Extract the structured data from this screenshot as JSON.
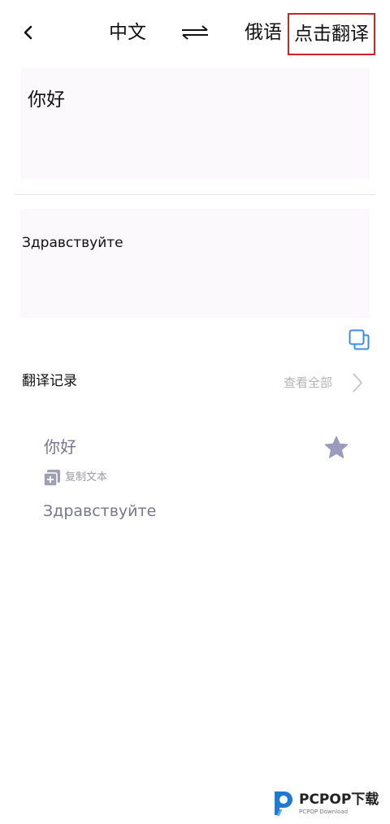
{
  "header": {
    "source_language": "中文",
    "target_language": "俄语",
    "translate_button": "点击翻译"
  },
  "input": {
    "text": "你好"
  },
  "result": {
    "text": "Здравствуйте"
  },
  "history": {
    "title": "翻译记录",
    "view_all": "查看全部",
    "items": [
      {
        "source": "你好",
        "copy_label": "复制文本",
        "translation": "Здравствуйте",
        "starred": true
      }
    ]
  },
  "watermark": {
    "name": "PCPOP下载",
    "subtitle": "PCPOP Download"
  },
  "icons": {
    "back": "chevron-left-icon",
    "swap": "swap-arrows-icon",
    "copy": "copy-icon",
    "star": "star-icon",
    "chevron": "chevron-right-icon",
    "copy_text": "copy-add-icon"
  },
  "colors": {
    "highlight_border": "#c8262b",
    "accent_blue": "#3a8ee6",
    "history_text": "#77778f",
    "star": "#9b9bbd",
    "panel_bg": "#fbf9fb"
  }
}
